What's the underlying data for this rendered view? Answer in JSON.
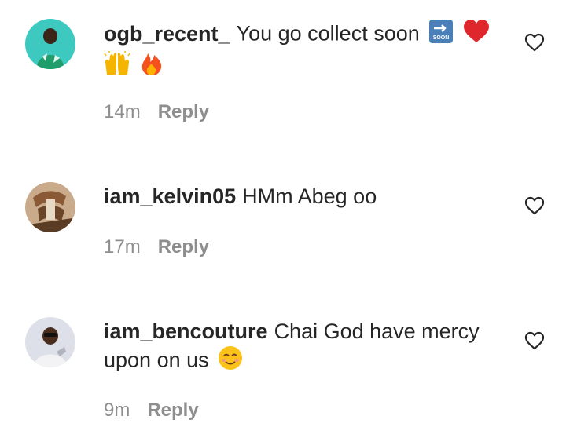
{
  "comments": [
    {
      "username": "ogb_recent_",
      "text": "You go collect soon",
      "emojis": [
        "soon-arrow-icon",
        "red-heart-icon",
        "raised-hands-icon",
        "fire-icon"
      ],
      "time": "14m",
      "reply_label": "Reply",
      "avatar_color": "#3ec9c0"
    },
    {
      "username": "iam_kelvin05",
      "text": "HMm Abeg oo",
      "time": "17m",
      "reply_label": "Reply",
      "avatar_color": "#b89270"
    },
    {
      "username": "iam_bencouture",
      "text": "Chai God have mercy upon on us",
      "emojis": [
        "smiling-face-icon"
      ],
      "time": "9m",
      "reply_label": "Reply",
      "avatar_color": "#d8dbe3"
    }
  ],
  "colors": {
    "text": "#262626",
    "secondary": "#8e8e8e"
  }
}
